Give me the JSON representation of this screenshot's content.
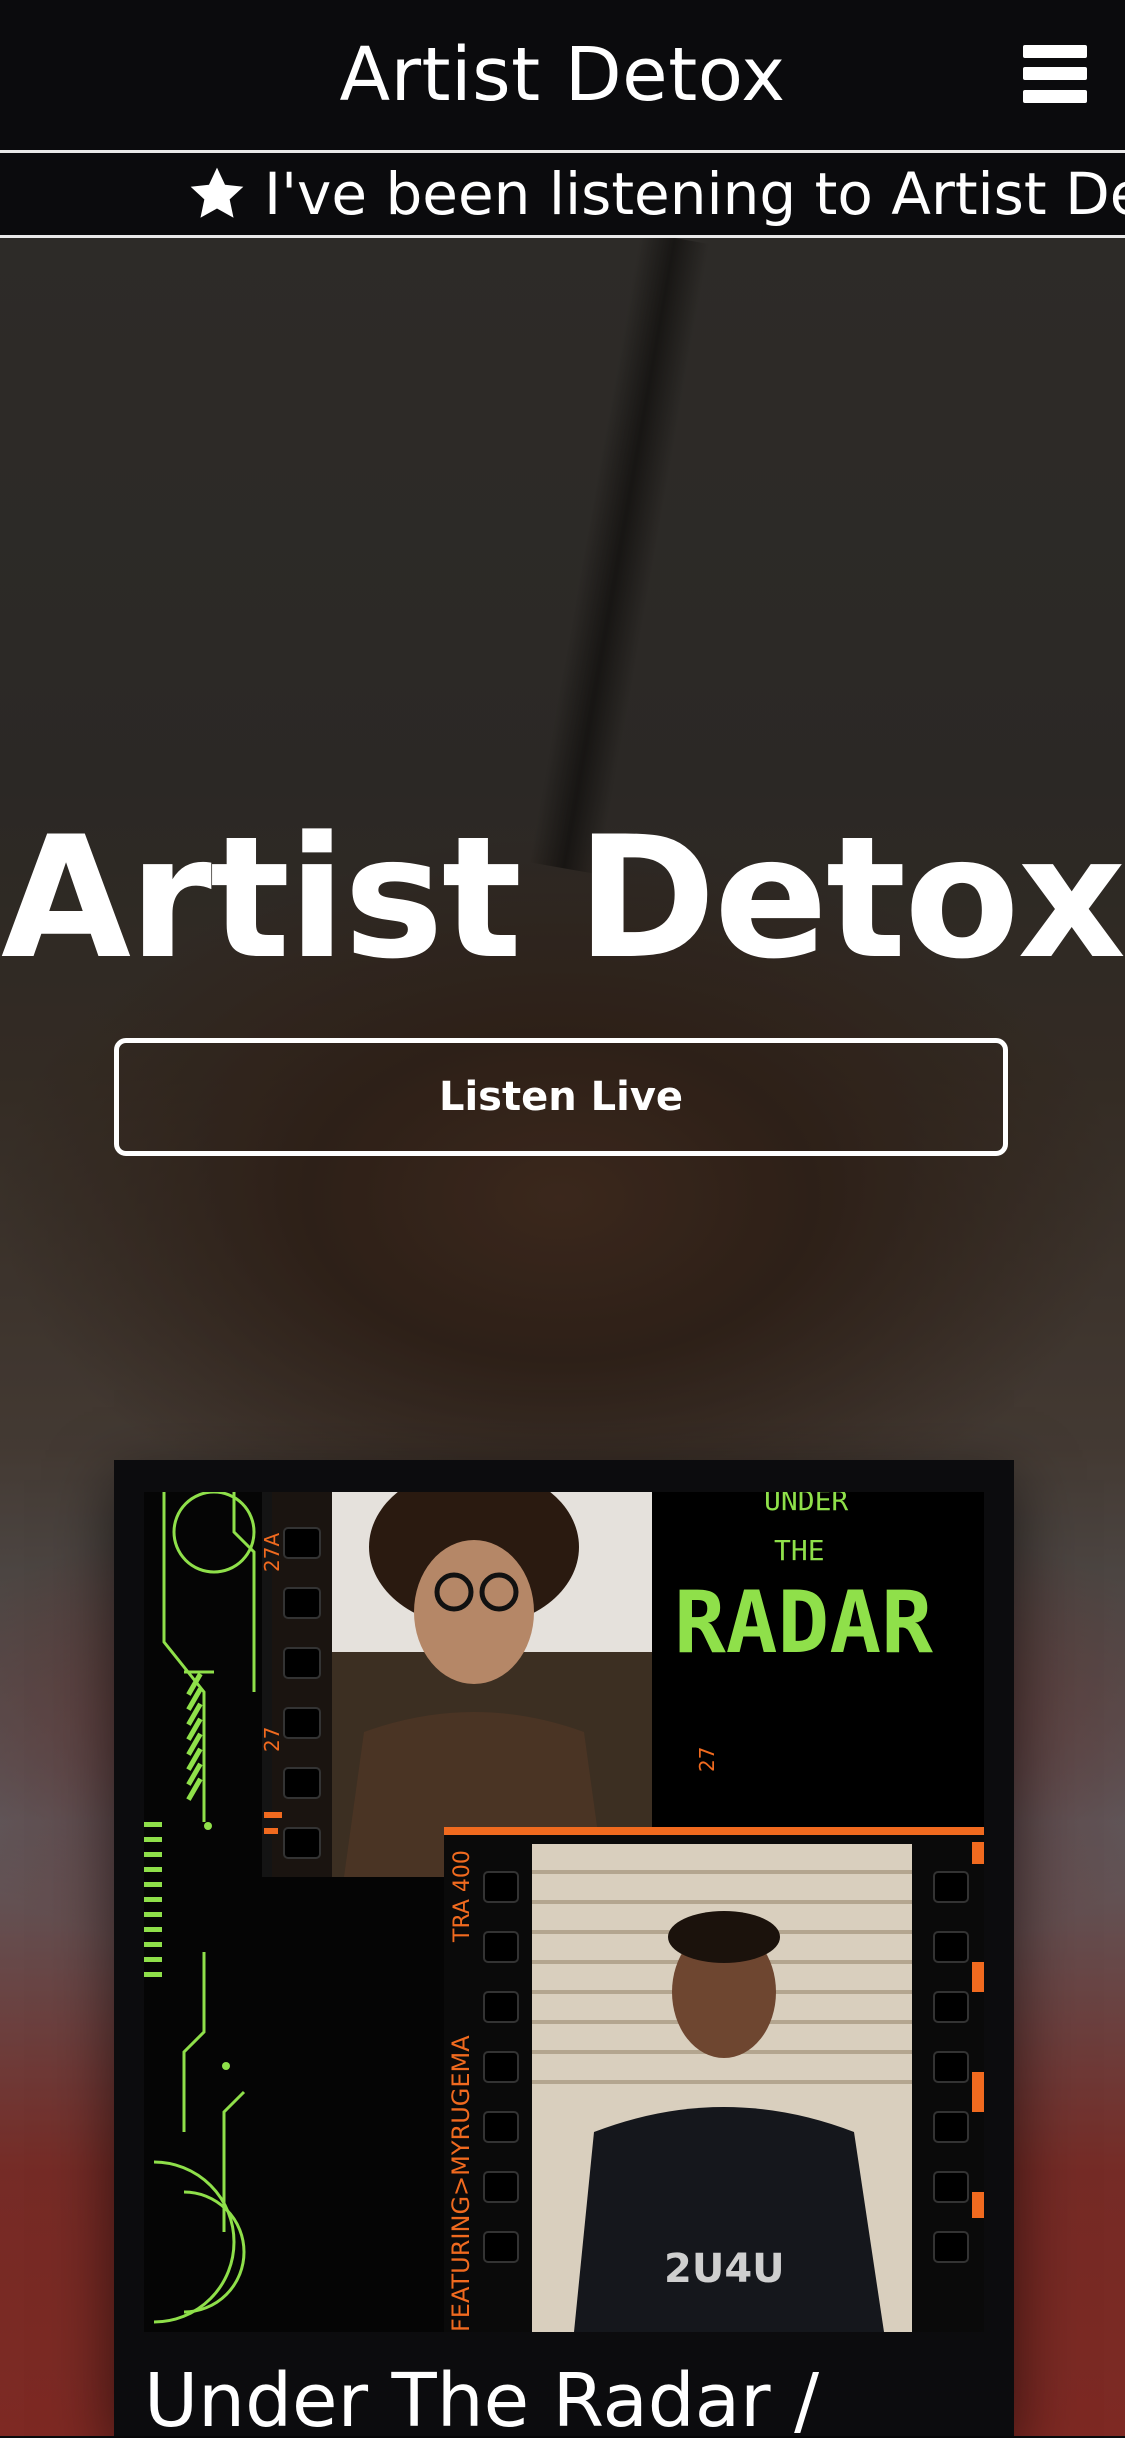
{
  "header": {
    "site_title": "Artist Detox",
    "menu_icon": "hamburger-menu-icon"
  },
  "ticker": {
    "icon": "star-icon",
    "text": "I've been listening to Artist Deotox"
  },
  "hero": {
    "title": "Artist Detox",
    "listen_button": "Listen Live"
  },
  "featured_card": {
    "artwork": {
      "headline_top": "UNDER",
      "headline_mid": "THE",
      "headline_main": "RADAR",
      "side_caption": "FEATURING>MYRUGEMA",
      "frame_code_a": "27A",
      "frame_code_b": "27",
      "film_code": "TRA 400",
      "shirt_text": "2U4U"
    },
    "title": "Under The Radar /"
  },
  "colors": {
    "accent_green": "#8fe04a",
    "film_orange": "#f06a1f",
    "background": "#0b0b0d"
  }
}
